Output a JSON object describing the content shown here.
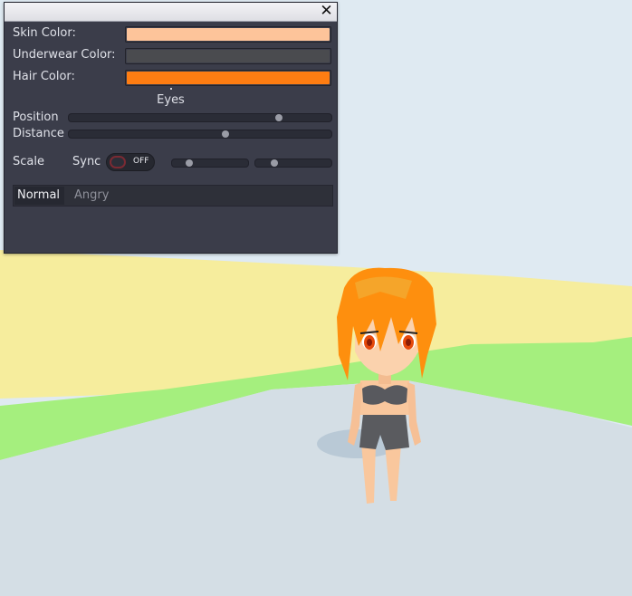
{
  "panel": {
    "close_label": "✕",
    "skin": {
      "label": "Skin Color:",
      "color": "#fdc49a"
    },
    "underwear": {
      "label": "Underwear Color:",
      "color": "#4a4b4f"
    },
    "hair": {
      "label": "Hair Color:",
      "color": "#fe7d12"
    },
    "eyes": {
      "title": "Eyes",
      "position": {
        "label": "Position",
        "value": 0.81
      },
      "distance": {
        "label": "Distance",
        "value": 0.6
      },
      "scale": {
        "label": "Scale",
        "sync_label": "Sync",
        "toggle_text": "OFF",
        "toggle_on": false,
        "slider_a": 0.2,
        "slider_b": 0.22
      }
    },
    "tabs": [
      {
        "label": "Normal",
        "active": true
      },
      {
        "label": "Angry",
        "active": false
      }
    ]
  },
  "scene": {
    "sky_color": "#dfeaf2",
    "sand_color": "#f6ed9d",
    "grass_color": "#a5ef7e",
    "floor_color": "#d3dde4",
    "hair_color": "#fe8f0e",
    "skin_color": "#fdc49a",
    "eye_color": "#e64a0c",
    "underwear_color": "#58595e"
  }
}
